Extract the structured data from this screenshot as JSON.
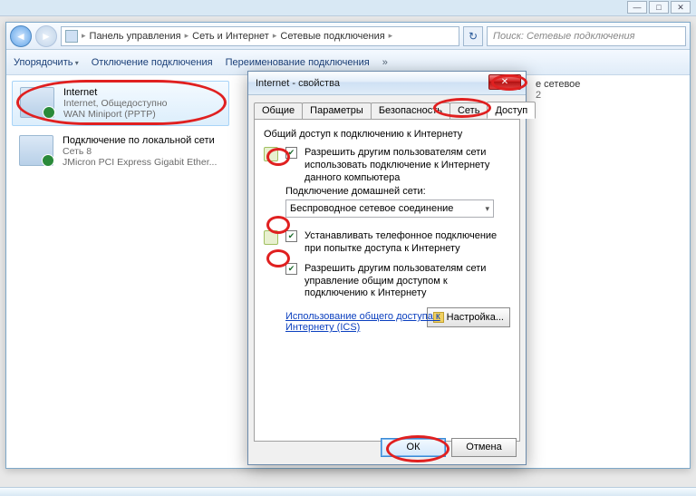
{
  "window_controls": {
    "min": "—",
    "max": "□",
    "close": "✕"
  },
  "breadcrumb": {
    "root": "Панель управления",
    "cat": "Сеть и Интернет",
    "page": "Сетевые подключения",
    "icon": "network-icon"
  },
  "search": {
    "placeholder": "Поиск: Сетевые подключения"
  },
  "toolbar": {
    "organize": "Упорядочить",
    "disable": "Отключение подключения",
    "rename": "Переименование подключения",
    "more": "»"
  },
  "connections": [
    {
      "title": "Internet",
      "line2": "Internet, Общедоступно",
      "line3": "WAN Miniport (PPTP)",
      "selected": true
    },
    {
      "title": "Подключение по локальной сети",
      "line2": "Сеть 8",
      "line3": "JMicron PCI Express Gigabit Ether...",
      "selected": false
    }
  ],
  "side_label": {
    "l1": "е сетевое",
    "l2": "2"
  },
  "dialog": {
    "title": "Internet - свойства",
    "close": "✕",
    "tabs": {
      "general": "Общие",
      "params": "Параметры",
      "security": "Безопасность",
      "network": "Сеть",
      "sharing": "Доступ"
    },
    "group_heading": "Общий доступ к подключению к Интернету",
    "opt1": "Разрешить другим пользователям сети использовать подключение к Интернету данного компьютера",
    "home_label": "Подключение домашней сети:",
    "home_value": "Беспроводное сетевое соединение",
    "opt2": "Устанавливать телефонное подключение при попытке доступа к Интернету",
    "opt3": "Разрешить другим пользователям сети управление общим доступом к подключению к Интернету",
    "link": "Использование общего доступа к Интернету (ICS)",
    "settings_btn": "Настройка...",
    "ok": "ОК",
    "cancel": "Отмена"
  }
}
